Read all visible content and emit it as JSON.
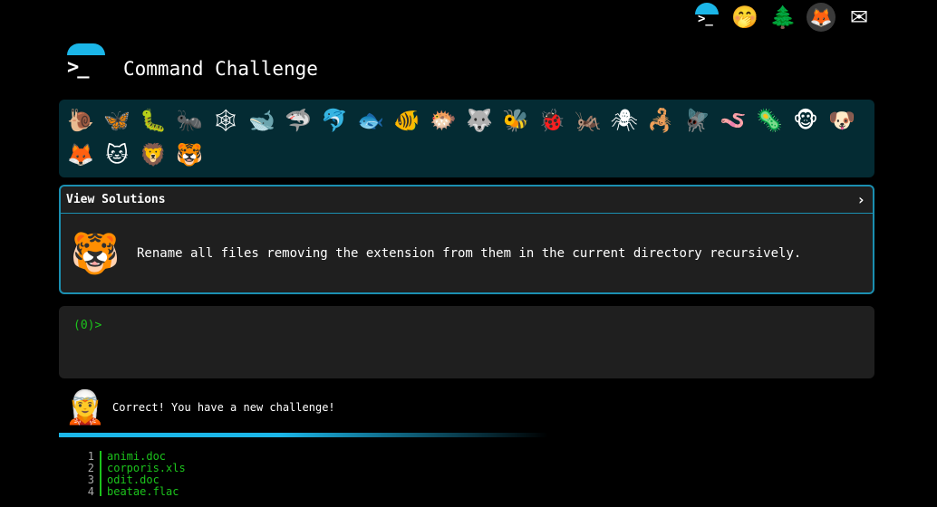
{
  "nav": {
    "icons": [
      {
        "name": "terminal-icon",
        "glyph": ">_"
      },
      {
        "name": "shush-face-icon",
        "glyph": "🤭"
      },
      {
        "name": "tree-icon",
        "glyph": "🌲"
      },
      {
        "name": "gitlab-icon",
        "glyph": "🦊"
      },
      {
        "name": "mail-icon",
        "glyph": "✉"
      }
    ]
  },
  "logo": {
    "prompt": ">_"
  },
  "header": {
    "title": "Command Challenge"
  },
  "animals": [
    {
      "name": "snail-icon",
      "glyph": "🐌"
    },
    {
      "name": "butterfly-icon",
      "glyph": "🦋"
    },
    {
      "name": "caterpillar-icon",
      "glyph": "🐛"
    },
    {
      "name": "ant-icon",
      "glyph": "🐜"
    },
    {
      "name": "spider-web-icon",
      "glyph": "🕸"
    },
    {
      "name": "whale-icon",
      "glyph": "🐋"
    },
    {
      "name": "shark-icon",
      "glyph": "🦈"
    },
    {
      "name": "dolphin-icon",
      "glyph": "🐬"
    },
    {
      "name": "fish-icon",
      "glyph": "🐟"
    },
    {
      "name": "tropical-fish-icon",
      "glyph": "🐠"
    },
    {
      "name": "blowfish-icon",
      "glyph": "🐡"
    },
    {
      "name": "wolf-icon",
      "glyph": "🐺"
    },
    {
      "name": "bee-icon",
      "glyph": "🐝"
    },
    {
      "name": "ladybug-icon",
      "glyph": "🐞"
    },
    {
      "name": "cricket-icon",
      "glyph": "🦗"
    },
    {
      "name": "spider-icon",
      "glyph": "🕷"
    },
    {
      "name": "scorpion-icon",
      "glyph": "🦂"
    },
    {
      "name": "fly-icon",
      "glyph": "🪰"
    },
    {
      "name": "worm-icon",
      "glyph": "🪱"
    },
    {
      "name": "microbe-icon",
      "glyph": "🦠"
    },
    {
      "name": "monkey-icon",
      "glyph": "🐵"
    },
    {
      "name": "dog-icon",
      "glyph": "🐶"
    },
    {
      "name": "fox-icon",
      "glyph": "🦊"
    },
    {
      "name": "cat-icon",
      "glyph": "🐱"
    },
    {
      "name": "lion-icon",
      "glyph": "🦁"
    },
    {
      "name": "tiger-icon",
      "glyph": "🐯"
    }
  ],
  "challenge": {
    "header_label": "View Solutions",
    "chevron": "›",
    "emblem": "🐯",
    "task": "Rename all files removing the extension from them in the current directory recursively."
  },
  "terminal": {
    "prompt": "(0)>",
    "input": ""
  },
  "result": {
    "avatar": "🧝",
    "message": "Correct! You have a new challenge!"
  },
  "files": [
    {
      "num": "1",
      "name": "animi.doc"
    },
    {
      "num": "2",
      "name": "corporis.xls"
    },
    {
      "num": "3",
      "name": "odit.doc"
    },
    {
      "num": "4",
      "name": "beatae.flac"
    }
  ],
  "colors": {
    "accent": "#1bb6e8",
    "prompt_green": "#1cc41c",
    "panel": "#1f1f1f",
    "animal_bar": "#042b33"
  }
}
